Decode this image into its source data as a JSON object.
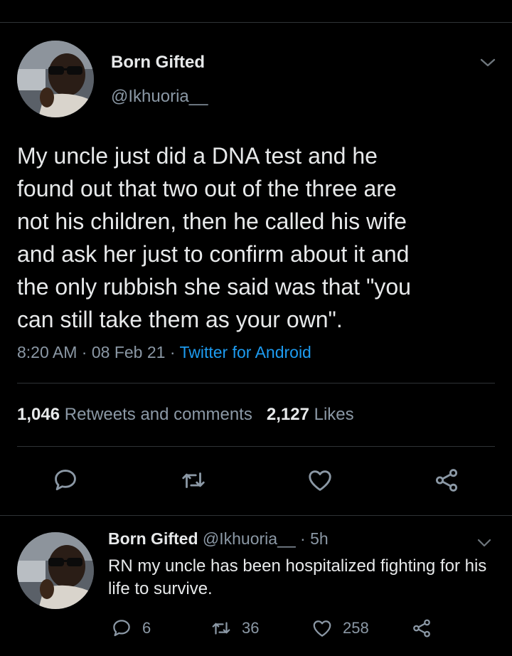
{
  "main_tweet": {
    "display_name": "Born Gifted",
    "handle": "@Ikhuoria__",
    "text": "My uncle just did a DNA test and he\nfound out that two out of the three  are\nnot his children, then he called his wife\nand ask her just to confirm about it and\nthe only rubbish she said was that \"you\ncan still take them as your own\".",
    "time": "8:20 AM",
    "date": "08 Feb 21",
    "separator": "·",
    "source": "Twitter for Android",
    "retweets_count": "1,046",
    "retweets_label": "Retweets and comments",
    "likes_count": "2,127",
    "likes_label": "Likes"
  },
  "reply_tweet": {
    "display_name": "Born Gifted",
    "handle": "@Ikhuoria__",
    "age": "5h",
    "separator": "·",
    "text": "RN my uncle has been hospitalized fighting for his life to survive.",
    "reply_count": "6",
    "retweet_count": "36",
    "like_count": "258"
  },
  "icons": {
    "reply": "speech-bubble-icon",
    "retweet": "retweet-arrows-icon",
    "like": "heart-icon",
    "share": "share-nodes-icon",
    "more": "chevron-down-icon"
  },
  "colors": {
    "background": "#000000",
    "text": "#e7e9ea",
    "muted": "#8b98a5",
    "link": "#1d9bf0",
    "divider": "#2f3336"
  }
}
